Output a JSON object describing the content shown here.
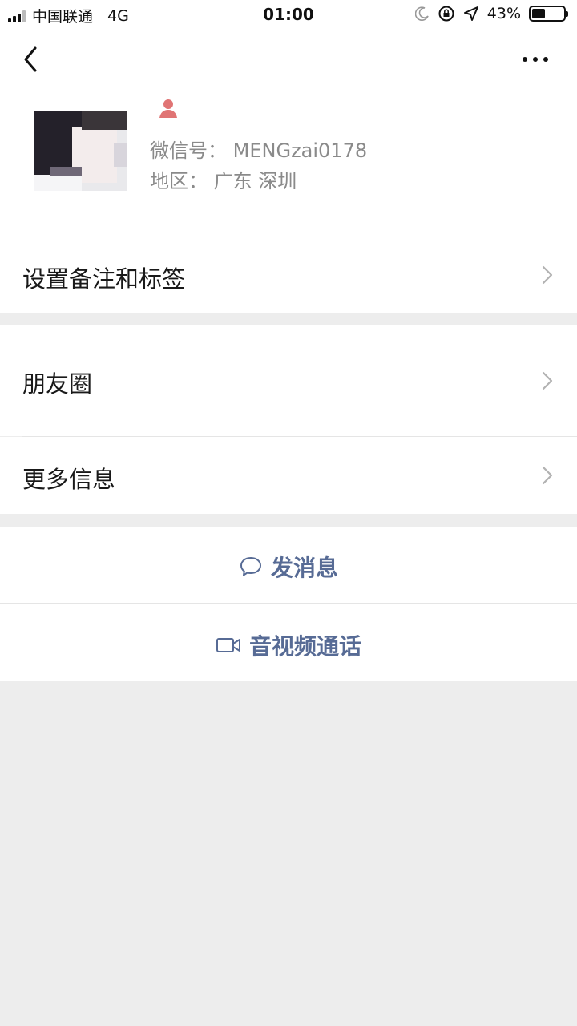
{
  "status_bar": {
    "carrier": "中国联通",
    "network": "4G",
    "time": "01:00",
    "battery_percent": "43%",
    "battery_level": 0.43
  },
  "nav": {
    "back_icon": "chevron-left-icon",
    "more_icon": "more-dots-icon"
  },
  "profile": {
    "gender_icon": "female-icon",
    "wechat_id_label": "微信号：",
    "wechat_id_value": "MENGzai0178",
    "region_label": "地区：",
    "region_value": "广东 深圳"
  },
  "menu": {
    "remark_tags": "设置备注和标签",
    "moments": "朋友圈",
    "more_info": "更多信息"
  },
  "actions": {
    "send_message": "发消息",
    "av_call": "音视频通话"
  },
  "colors": {
    "link_blue": "#576b95",
    "background": "#ededed",
    "female_pink": "#e07474"
  }
}
